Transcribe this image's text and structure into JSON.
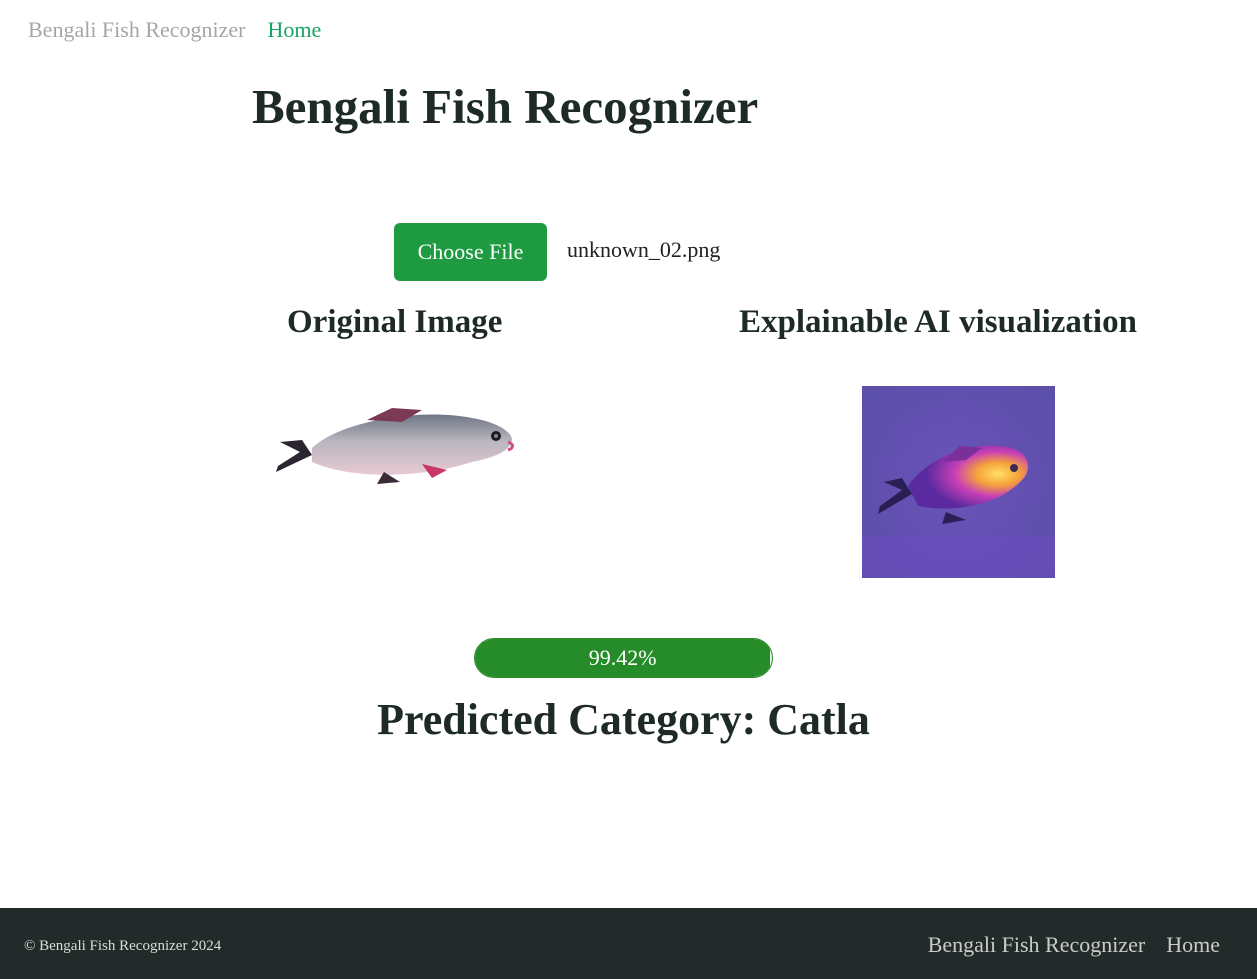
{
  "nav": {
    "brand": "Bengali Fish Recognizer",
    "home": "Home"
  },
  "page_title": "Bengali Fish Recognizer",
  "file_input": {
    "button_label": "Choose File",
    "file_name": "unknown_02.png"
  },
  "sections": {
    "original_title": "Original Image",
    "xai_title": "Explainable AI visualization"
  },
  "result": {
    "confidence_label": "99.42%",
    "confidence_value": 0.9942,
    "predicted": "Predicted Category: Catla"
  },
  "footer": {
    "copyright": "© Bengali Fish Recognizer 2024",
    "brand": "Bengali Fish Recognizer",
    "home": "Home"
  },
  "colors": {
    "accent": "#1e9b40",
    "progress": "#268b29",
    "footer_bg": "#232a2a",
    "link": "#1aa365"
  }
}
